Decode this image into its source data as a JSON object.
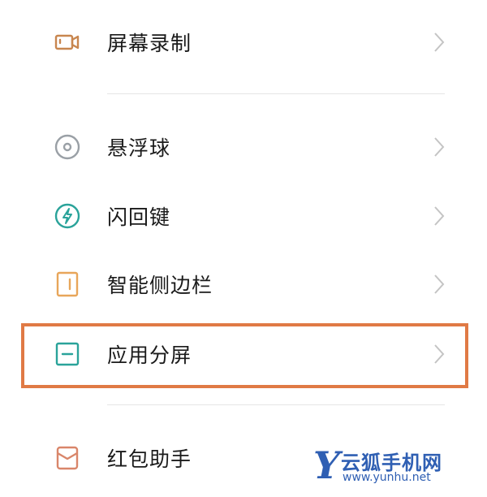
{
  "settings": {
    "items": [
      {
        "label": "屏幕录制",
        "icon": "video-camera-icon",
        "color": "#c8864f"
      },
      {
        "label": "悬浮球",
        "icon": "floating-ball-icon",
        "color": "#9aa0a6"
      },
      {
        "label": "闪回键",
        "icon": "lightning-icon",
        "color": "#2aa39a"
      },
      {
        "label": "智能侧边栏",
        "icon": "sidebar-icon",
        "color": "#e8a65a"
      },
      {
        "label": "应用分屏",
        "icon": "split-screen-icon",
        "color": "#2aa39a"
      },
      {
        "label": "红包助手",
        "icon": "envelope-icon",
        "color": "#d9866a"
      }
    ],
    "highlighted_item": "应用分屏",
    "highlight_color": "#e07a45"
  },
  "watermark": {
    "letter": "Y",
    "name": "云狐手机网",
    "url": "www.yunhu.net",
    "color": "#2f5fb3"
  }
}
